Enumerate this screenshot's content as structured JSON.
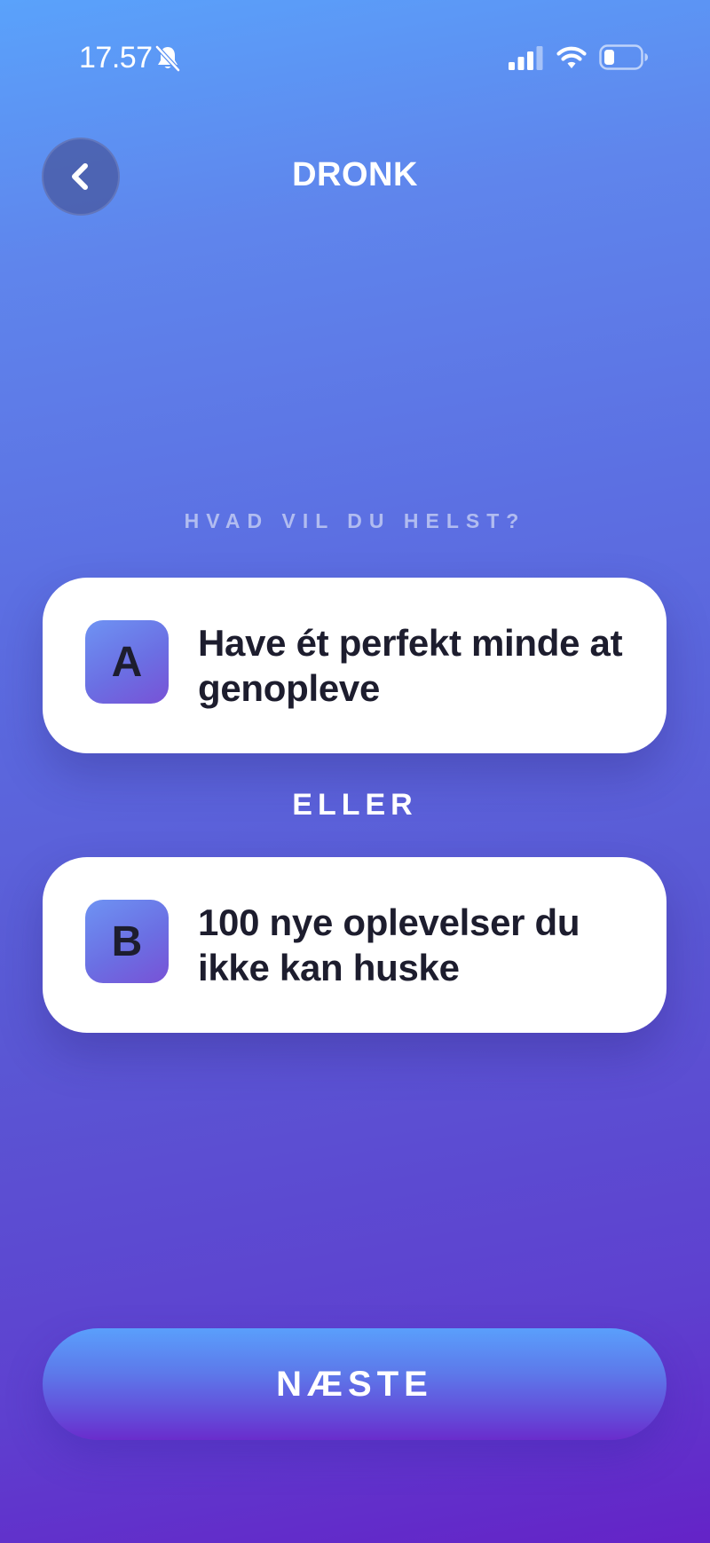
{
  "status_bar": {
    "time": "17.57",
    "icons": [
      "bell-slash-icon",
      "signal-icon",
      "wifi-icon",
      "battery-icon"
    ]
  },
  "header": {
    "back_icon": "chevron-left-icon",
    "title": "DRONK"
  },
  "question": {
    "label": "HVAD VIL DU HELST?",
    "separator": "ELLER",
    "options": [
      {
        "letter": "A",
        "text": "Have ét perfekt minde at genopleve"
      },
      {
        "letter": "B",
        "text": "100 nye oplevelser du ikke kan huske"
      }
    ]
  },
  "footer": {
    "next_label": "NÆSTE"
  },
  "colors": {
    "background_top": "#5aa2fb",
    "background_bottom": "#6423c7",
    "card": "#ffffff",
    "card_text": "#1d1d2e"
  }
}
